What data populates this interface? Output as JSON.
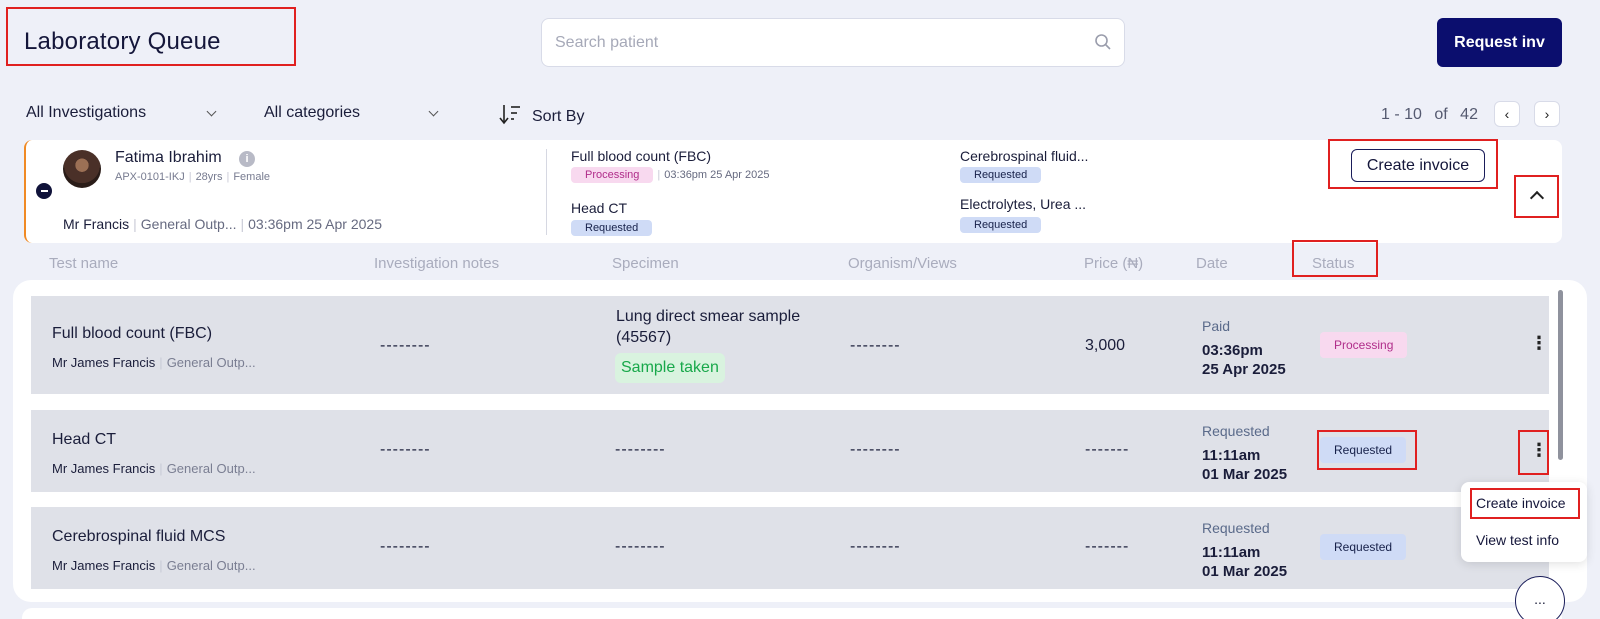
{
  "header": {
    "title": "Laboratory Queue",
    "search_placeholder": "Search patient",
    "request_btn": "Request inv"
  },
  "filters": {
    "investigations": "All Investigations",
    "categories": "All categories",
    "sort": "Sort By"
  },
  "pagination": {
    "range": "1 - 10",
    "of": "of",
    "total": "42"
  },
  "patient": {
    "name": "Fatima Ibrahim",
    "id": "APX-0101-IKJ",
    "age": "28yrs",
    "gender": "Female",
    "doctor": "Mr Francis",
    "department": "General Outp...",
    "datetime": "03:36pm 25 Apr 2025",
    "tests": [
      {
        "name": "Full blood count (FBC)",
        "status": "Processing",
        "date": "03:36pm 25 Apr 2025"
      },
      {
        "name": "Head CT",
        "status": "Requested"
      },
      {
        "name": "Cerebrospinal fluid...",
        "status": "Requested"
      },
      {
        "name": "Electrolytes, Urea ...",
        "status": "Requested"
      }
    ],
    "create_invoice": "Create invoice"
  },
  "table": {
    "headers": [
      "Test name",
      "Investigation notes",
      "Specimen",
      "Organism/Views",
      "Price (₦)",
      "Date",
      "Status"
    ],
    "rows": [
      {
        "name": "Full blood count (FBC)",
        "doctor": "Mr James Francis",
        "dept": "General Outp...",
        "notes": "--------",
        "specimen_line1": "Lung direct smear sample",
        "specimen_line2": "(45567)",
        "sample_badge": "Sample taken",
        "organism": "--------",
        "price": "3,000",
        "date_label": "Paid",
        "time": "03:36pm",
        "date": "25 Apr 2025",
        "status": "Processing"
      },
      {
        "name": "Head CT",
        "doctor": "Mr James Francis",
        "dept": "General Outp...",
        "notes": "--------",
        "specimen": "--------",
        "organism": "--------",
        "price": "-------",
        "date_label": "Requested",
        "time": "11:11am",
        "date": "01 Mar 2025",
        "status": "Requested"
      },
      {
        "name": "Cerebrospinal fluid MCS",
        "doctor": "Mr James Francis",
        "dept": "General Outp...",
        "notes": "--------",
        "specimen": "--------",
        "organism": "--------",
        "price": "-------",
        "date_label": "Requested",
        "time": "11:11am",
        "date": "01 Mar 2025",
        "status": "Requested"
      }
    ]
  },
  "menu": {
    "create_invoice": "Create invoice",
    "view_test_info": "View test info"
  },
  "fab": "...",
  "colors": {
    "primary": "#0b0e6e",
    "accent_border": "#f08a24",
    "annotation_red": "#e02020",
    "processing_bg": "#f8d9ef",
    "requested_bg": "#cfdbf6",
    "sample_taken": "#18a84a"
  }
}
